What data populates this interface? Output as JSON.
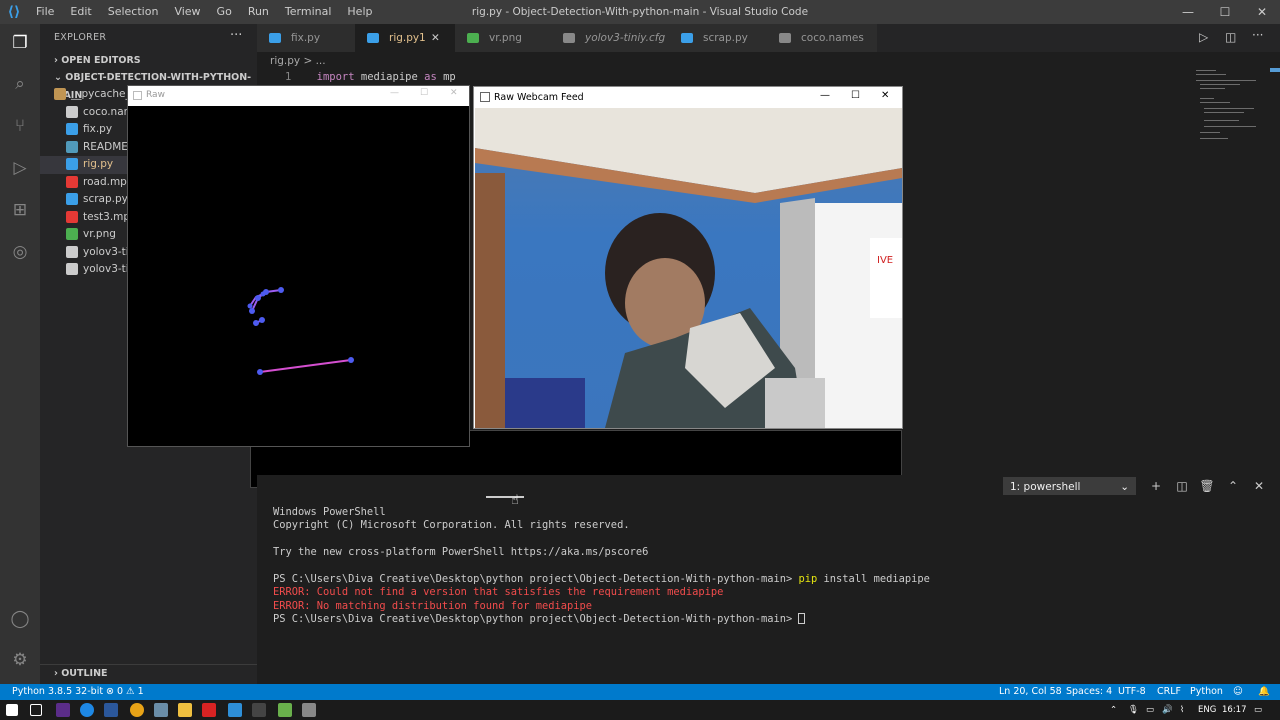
{
  "window": {
    "title": "rig.py - Object-Detection-With-python-main - Visual Studio Code",
    "minimize": "—",
    "maximize": "☐",
    "close": "✕"
  },
  "menu": [
    "File",
    "Edit",
    "Selection",
    "View",
    "Go",
    "Run",
    "Terminal",
    "Help"
  ],
  "sidebar": {
    "title": "EXPLORER",
    "more": "···",
    "open_editors": "OPEN EDITORS",
    "folder": "OBJECT-DETECTION-WITH-PYTHON-MAIN",
    "items": [
      {
        "label": "__pycache__",
        "icon": "folder-icon",
        "color": "#c09553"
      },
      {
        "label": "coco.names",
        "icon": "file-icon",
        "color": "#cccccc"
      },
      {
        "label": "fix.py",
        "icon": "python-icon",
        "color": "#3b9fe8"
      },
      {
        "label": "README.md",
        "icon": "markdown-icon",
        "color": "#519aba"
      },
      {
        "label": "rig.py",
        "icon": "python-icon",
        "color": "#3b9fe8",
        "selected": true
      },
      {
        "label": "road.mp4",
        "icon": "video-icon",
        "color": "#e53935"
      },
      {
        "label": "scrap.py",
        "icon": "python-icon",
        "color": "#3b9fe8"
      },
      {
        "label": "test3.mp4",
        "icon": "video-icon",
        "color": "#e53935"
      },
      {
        "label": "vr.png",
        "icon": "image-icon",
        "color": "#4caf50"
      },
      {
        "label": "yolov3-tiny.cfg",
        "icon": "gear-icon",
        "color": "#cccccc"
      },
      {
        "label": "yolov3-tiny.weights",
        "icon": "file-icon",
        "color": "#cccccc"
      }
    ],
    "outline": "OUTLINE"
  },
  "tabs": [
    {
      "label": "fix.py",
      "color": "#3b9fe8"
    },
    {
      "label": "rig.py",
      "badge": "1",
      "close": "✕",
      "color": "#3b9fe8",
      "active": true
    },
    {
      "label": "vr.png",
      "color": "#4caf50"
    },
    {
      "label": "yolov3-tiniy.cfg",
      "color": "#cccccc"
    },
    {
      "label": "scrap.py",
      "color": "#3b9fe8"
    },
    {
      "label": "coco.names",
      "color": "#cccccc"
    }
  ],
  "breadcrumb": "rig.py > ...",
  "code": {
    "line_number": "1",
    "keyword": "import",
    "module": "mediapipe",
    "as": "as",
    "alias": "mp"
  },
  "raw_window": {
    "title": "Raw"
  },
  "cam_window": {
    "title": "Raw Webcam Feed",
    "minimize": "—",
    "maximize": "☐",
    "close": "✕"
  },
  "panel": {
    "terminal_select": "1: powershell",
    "dropdown_icon": "chevron-down-icon"
  },
  "terminal": {
    "lines": [
      {
        "text": "Windows PowerShell",
        "cls": ""
      },
      {
        "text": "Copyright (C) Microsoft Corporation. All rights reserved.",
        "cls": ""
      },
      {
        "text": "",
        "cls": ""
      },
      {
        "text": "Try the new cross-platform PowerShell https://aka.ms/pscore6",
        "cls": ""
      },
      {
        "text": "",
        "cls": ""
      },
      {
        "prompt": "PS C:\\Users\\Diva Creative\\Desktop\\python project\\Object-Detection-With-python-main> ",
        "cmd": "pip",
        "rest": " install mediapipe"
      },
      {
        "text": "ERROR: Could not find a version that satisfies the requirement mediapipe",
        "cls": "err"
      },
      {
        "text": "ERROR: No matching distribution found for mediapipe",
        "cls": "err"
      },
      {
        "prompt": "PS C:\\Users\\Diva Creative\\Desktop\\python project\\Object-Detection-With-python-main> ",
        "cursor": true
      }
    ]
  },
  "status": {
    "python": "Python 3.8.5 32-bit",
    "problems": "⊗ 0 ⚠ 1",
    "position": "Ln 20, Col 58",
    "spaces": "Spaces: 4",
    "encoding": "UTF-8",
    "eol": "CRLF",
    "language": "Python"
  },
  "taskbar": {
    "lang": "ENG",
    "time": "16:17"
  }
}
